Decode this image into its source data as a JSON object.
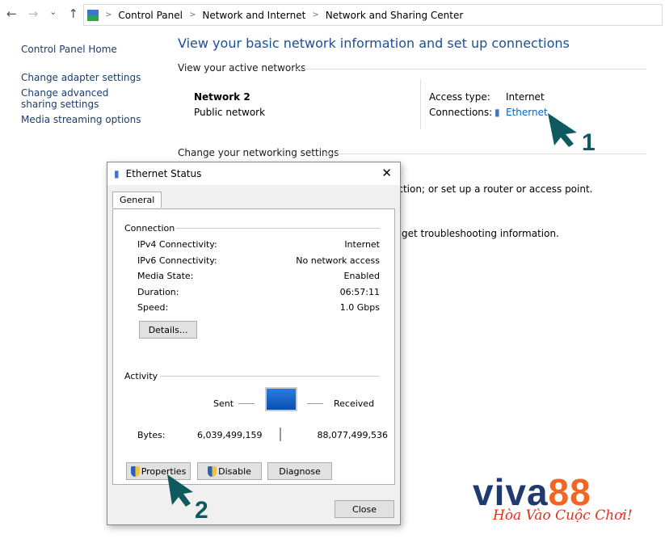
{
  "nav": {
    "back": "←",
    "forward": "→",
    "recent": "⌄",
    "up": "↑"
  },
  "breadcrumb": [
    "Control Panel",
    "Network and Internet",
    "Network and Sharing Center"
  ],
  "sidebar": {
    "home": "Control Panel Home",
    "items": [
      "Change adapter settings",
      "Change advanced sharing settings",
      "Media streaming options"
    ]
  },
  "main": {
    "title": "View your basic network information and set up connections",
    "active_networks": "View your active networks",
    "network_name": "Network 2",
    "network_type": "Public network",
    "access_type_label": "Access type:",
    "access_type": "Internet",
    "connections_label": "Connections:",
    "connection": "Ethernet",
    "change_settings": "Change your networking settings",
    "partial1": "ection; or set up a router or access point.",
    "partial2": "get troubleshooting information."
  },
  "dialog": {
    "title": "Ethernet Status",
    "tab": "General",
    "connection_label": "Connection",
    "rows": [
      {
        "label": "IPv4 Connectivity:",
        "value": "Internet"
      },
      {
        "label": "IPv6 Connectivity:",
        "value": "No network access"
      },
      {
        "label": "Media State:",
        "value": "Enabled"
      },
      {
        "label": "Duration:",
        "value": "06:57:11"
      },
      {
        "label": "Speed:",
        "value": "1.0 Gbps"
      }
    ],
    "details": "Details...",
    "activity_label": "Activity",
    "sent": "Sent",
    "received": "Received",
    "bytes_label": "Bytes:",
    "bytes_sent": "6,039,499,159",
    "bytes_received": "88,077,499,536",
    "properties": "Properties",
    "disable": "Disable",
    "diagnose": "Diagnose",
    "close": "Close"
  },
  "annotations": {
    "step1": "1",
    "step2": "2",
    "color": "#0f5a5e"
  },
  "logo": {
    "text1": "viva",
    "text2": "88",
    "tagline": "Hòa Vào Cuộc Chơi!",
    "blue": "#1e3a6e",
    "orange": "#f26522"
  }
}
